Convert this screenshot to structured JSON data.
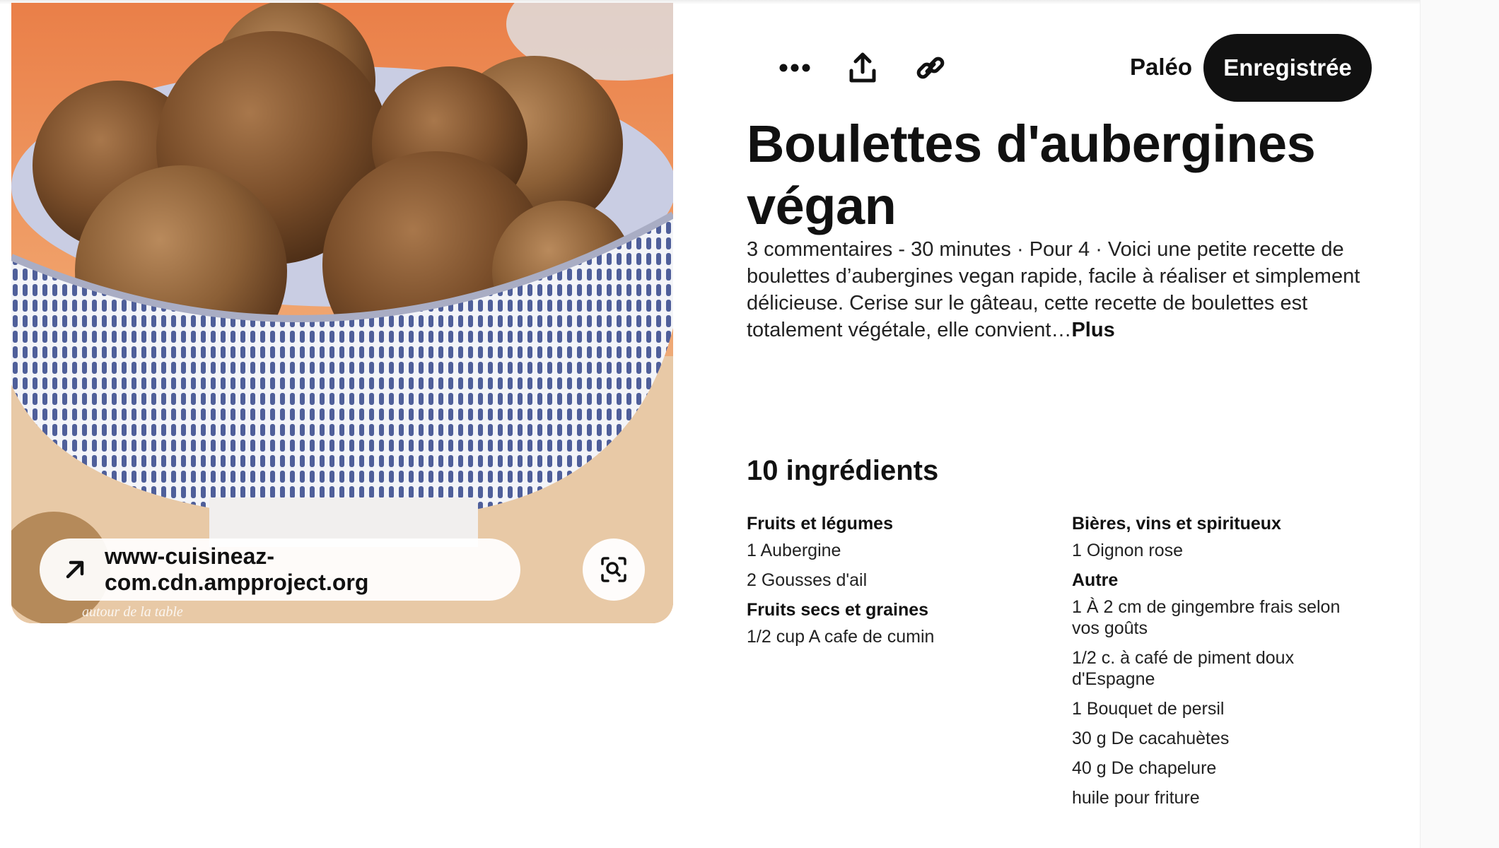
{
  "image": {
    "source_label": "www-cuisineaz-com.cdn.ampproject.org",
    "watermark_text": "autour de la table",
    "source_icon": "arrow-up-right-icon",
    "lens_icon": "visual-search-icon"
  },
  "toolbar": {
    "more_icon": "ellipsis-icon",
    "share_icon": "share-upload-icon",
    "link_icon": "link-chain-icon",
    "board_name": "Paléo",
    "save_label": "Enregistrée"
  },
  "recipe": {
    "title": "Boulettes d'aubergines végan",
    "description": "3 commentaires - 30 minutes · Pour 4 · Voici une petite recette de boulettes d’aubergines vegan rapide, facile à réaliser et simplement délicieuse. Cerise sur le gâteau, cette recette de boulettes est totalement végétale, elle convient…",
    "more_label": "Plus"
  },
  "ingredients": {
    "heading": "10 ingrédients",
    "left_groups": [
      {
        "title": "Fruits et légumes",
        "items": [
          "1 Aubergine",
          "2 Gousses d'ail"
        ]
      },
      {
        "title": "Fruits secs et graines",
        "items": [
          "1/2 cup A cafe de cumin"
        ]
      }
    ],
    "right_groups": [
      {
        "title": "Bières, vins et spiritueux",
        "items": [
          "1 Oignon rose"
        ]
      },
      {
        "title": "Autre",
        "items": [
          "1 À 2 cm de gingembre frais selon vos goûts",
          "1/2 c. à café de piment doux d'Espagne",
          "1 Bouquet de persil",
          "30 g De cacahuètes",
          "40 g De chapelure",
          "huile pour friture"
        ]
      }
    ]
  },
  "colors": {
    "primary_button": "#111111",
    "background": "#ffffff"
  }
}
